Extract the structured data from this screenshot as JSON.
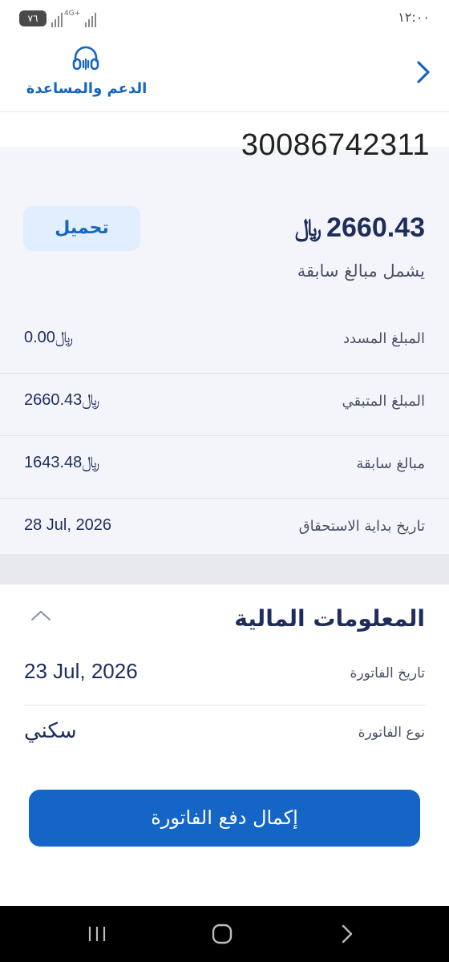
{
  "status_bar": {
    "battery": "٧٦",
    "network": "4G+",
    "time": "١٢:٠٠"
  },
  "header": {
    "support_label": "الدعم والمساعدة"
  },
  "summary": {
    "account_number": "30086742311",
    "total_amount": "2660.43",
    "currency_symbol": "﷼",
    "includes_previous": "يشمل مبالغ سابقة",
    "download_label": "تحميل",
    "rows": [
      {
        "label": "المبلغ المسدد",
        "value": "0.00"
      },
      {
        "label": "المبلغ المتبقي",
        "value": "2660.43"
      },
      {
        "label": "مبالغ سابقة",
        "value": "1643.48"
      },
      {
        "label": "تاريخ بداية الاستحقاق",
        "value": "28 Jul, 2026"
      }
    ]
  },
  "financial_info": {
    "title": "المعلومات المالية",
    "rows": [
      {
        "label": "تاريخ الفاتورة",
        "value": "23 Jul, 2026"
      },
      {
        "label": "نوع الفاتورة",
        "value": "سكني"
      }
    ]
  },
  "pay_button": {
    "label": "إكمال دفع الفاتورة"
  },
  "colors": {
    "primary": "#1565c7",
    "text_dark": "#1e2d5c",
    "card_bg": "#f3f5fa",
    "button_light": "#e0eefd"
  }
}
